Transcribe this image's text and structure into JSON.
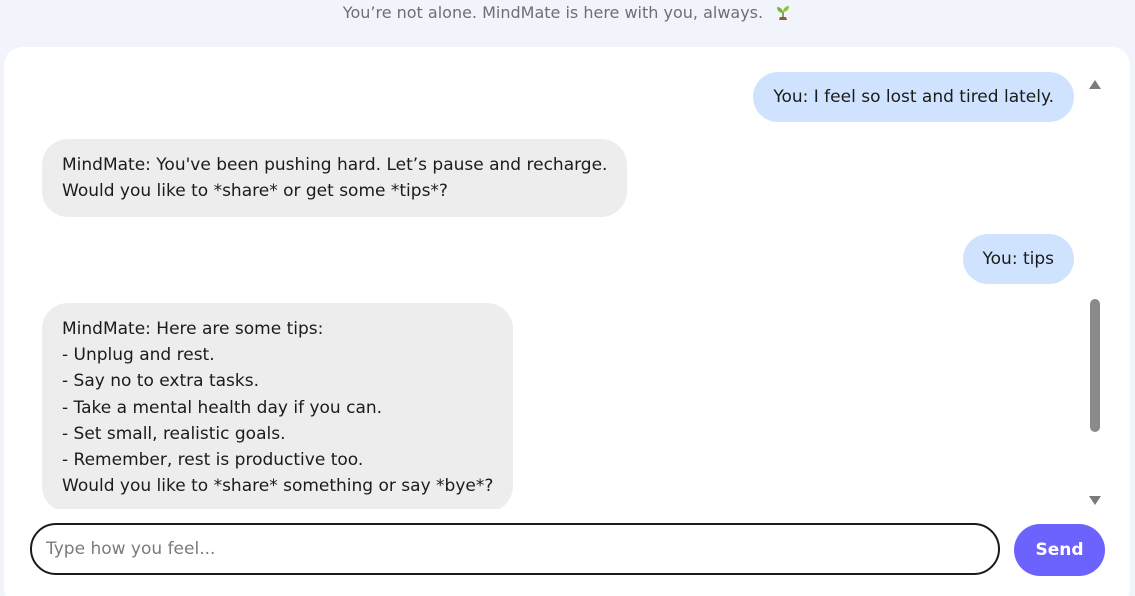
{
  "header": {
    "tagline": "You’re not alone. MindMate is here with you, always.",
    "tagline_icon": "seedling-icon"
  },
  "chat": {
    "messages": [
      {
        "role": "user",
        "text": "You: I feel so lost and tired lately."
      },
      {
        "role": "bot",
        "text": "MindMate: You've been pushing hard. Let’s pause and recharge.\nWould you like to *share* or get some *tips*?"
      },
      {
        "role": "user",
        "text": "You: tips"
      },
      {
        "role": "bot",
        "text": "MindMate: Here are some tips:\n- Unplug and rest.\n- Say no to extra tasks.\n- Take a mental health day if you can.\n- Set small, realistic goals.\n- Remember, rest is productive too.\nWould you like to *share* something or say *bye*?"
      }
    ]
  },
  "composer": {
    "placeholder": "Type how you feel...",
    "value": "",
    "send_label": "Send"
  },
  "colors": {
    "user_bubble": "#cfe3fe",
    "bot_bubble": "#ededed",
    "accent": "#6c63ff",
    "background": "#f2f4fb"
  }
}
